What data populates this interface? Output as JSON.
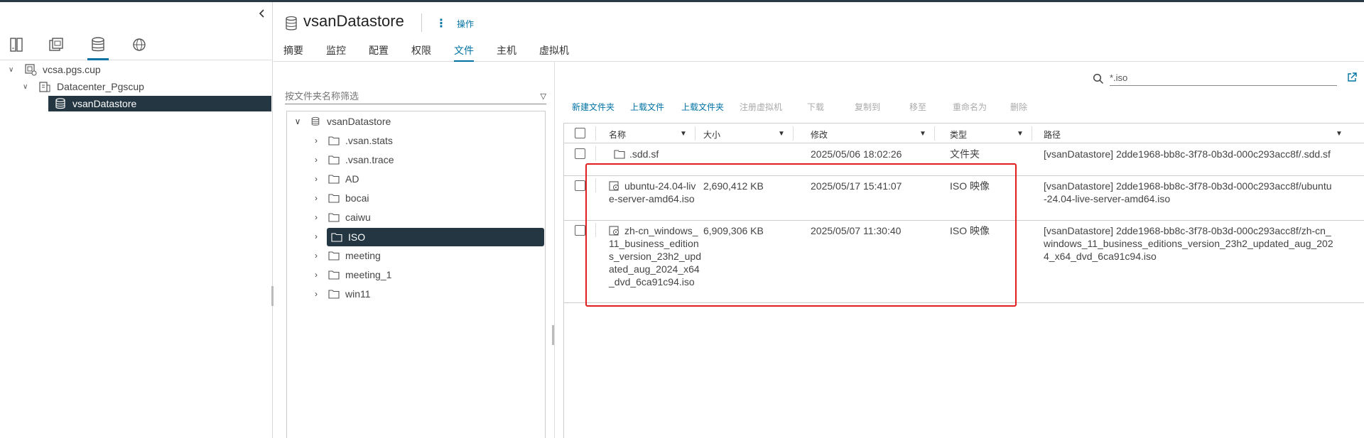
{
  "navigator": {
    "tree": [
      {
        "label": "vcsa.pgs.cup"
      },
      {
        "label": "Datacenter_Pgscup"
      },
      {
        "label": "vsanDatastore"
      }
    ]
  },
  "header": {
    "title": "vsanDatastore",
    "actions_label": "操作",
    "tabs": [
      {
        "label": "摘要"
      },
      {
        "label": "监控"
      },
      {
        "label": "配置"
      },
      {
        "label": "权限"
      },
      {
        "label": "文件"
      },
      {
        "label": "主机"
      },
      {
        "label": "虚拟机"
      }
    ]
  },
  "search": {
    "value": "*.iso"
  },
  "folders": {
    "filter_placeholder": "按文件夹名称筛选",
    "root": "vsanDatastore",
    "items": [
      {
        "label": ".vsan.stats"
      },
      {
        "label": ".vsan.trace"
      },
      {
        "label": "AD"
      },
      {
        "label": "bocai"
      },
      {
        "label": "caiwu"
      },
      {
        "label": "ISO"
      },
      {
        "label": "meeting"
      },
      {
        "label": "meeting_1"
      },
      {
        "label": "win11"
      }
    ]
  },
  "toolbar": {
    "new_folder": "新建文件夹",
    "upload_file": "上载文件",
    "upload_folder": "上载文件夹",
    "register_vm": "注册虚拟机",
    "download": "下载",
    "copy_to": "复制到",
    "move_to": "移至",
    "rename": "重命名为",
    "delete": "删除"
  },
  "grid": {
    "columns": {
      "name": "名称",
      "size": "大小",
      "modified": "修改",
      "type": "类型",
      "path": "路径"
    },
    "rows": [
      {
        "name": ".sdd.sf",
        "size": "",
        "modified": "2025/05/06 18:02:26",
        "type": "文件夹",
        "path": "[vsanDatastore] 2dde1968-bb8c-3f78-0b3d-000c293acc8f/.sdd.sf",
        "icon": "folder-icon"
      },
      {
        "name": "ubuntu-24.04-live-server-amd64.iso",
        "size": "2,690,412 KB",
        "modified": "2025/05/17 15:41:07",
        "type": "ISO 映像",
        "path": "[vsanDatastore] 2dde1968-bb8c-3f78-0b3d-000c293acc8f/ubuntu-24.04-live-server-amd64.iso",
        "icon": "disc-image-icon"
      },
      {
        "name": "zh-cn_windows_11_business_editions_version_23h2_updated_aug_2024_x64_dvd_6ca91c94.iso",
        "size": "6,909,306 KB",
        "modified": "2025/05/07 11:30:40",
        "type": "ISO 映像",
        "path": "[vsanDatastore] 2dde1968-bb8c-3f78-0b3d-000c293acc8f/zh-cn_windows_11_business_editions_version_23h2_updated_aug_2024_x64_dvd_6ca91c94.iso",
        "icon": "disc-image-icon"
      }
    ]
  },
  "colors": {
    "accent": "#0072a3",
    "selected_bg": "#243641",
    "highlight_border": "#e21d1d"
  }
}
